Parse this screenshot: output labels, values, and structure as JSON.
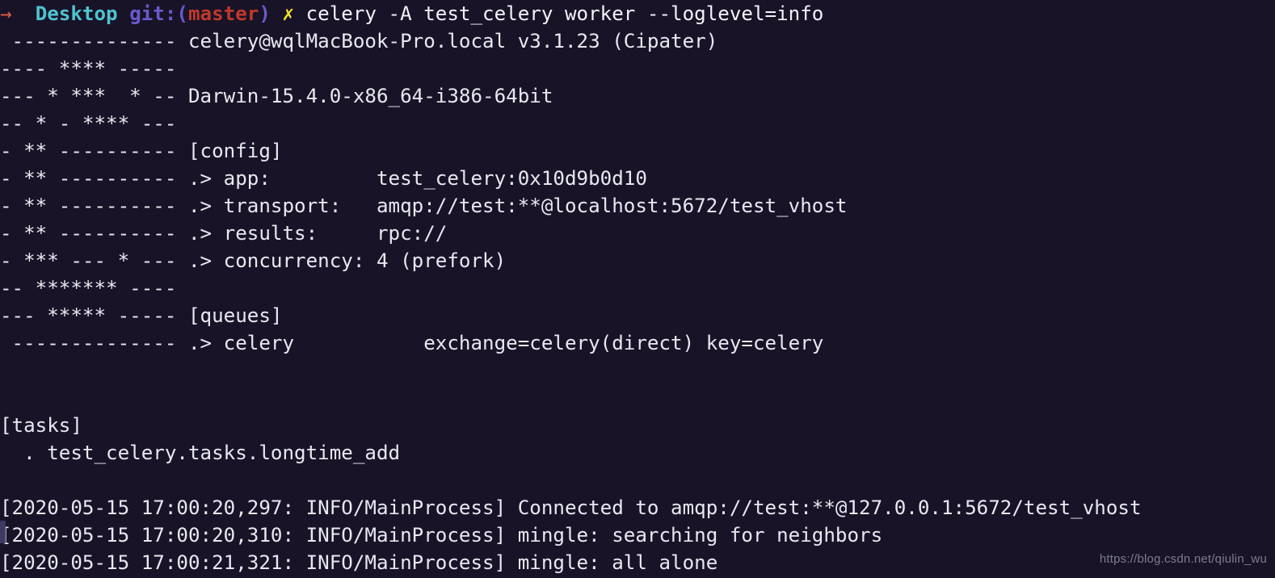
{
  "terminal": {
    "background_color": "#191328",
    "foreground_color": "#e8e8ee",
    "prompt": {
      "arrow": "→",
      "arrow_color": "#e05c4a",
      "directory": "Desktop",
      "directory_color": "#4fc4cf",
      "git_prefix": "git:(",
      "git_color": "#6a5acd",
      "branch": "master",
      "branch_color": "#c0392b",
      "git_suffix": ")",
      "status_mark": "✗",
      "status_mark_color": "#f2e42b",
      "command": "celery -A test_celery worker --loglevel=info"
    },
    "banner": {
      "art_lines": [
        " --------------",
        "---- **** -----",
        "--- * ***  * --",
        "-- * - **** ---",
        "- ** ----------",
        "- ** ----------",
        "- ** ----------",
        "- ** ----------",
        "- *** --- * ---",
        "-- ******* ----",
        "--- ***** -----",
        " --------------"
      ],
      "right_lines": [
        "celery@wqlMacBook-Pro.local v3.1.23 (Cipater)",
        "",
        "Darwin-15.4.0-x86_64-i386-64bit",
        "",
        "[config]",
        ".> app:         test_celery:0x10d9b0d10",
        ".> transport:   amqp://test:**@localhost:5672/test_vhost",
        ".> results:     rpc://",
        ".> concurrency: 4 (prefork)",
        "",
        "[queues]",
        ".> celery           exchange=celery(direct) key=celery"
      ]
    },
    "tasks": {
      "header": "[tasks]",
      "items": [
        "  . test_celery.tasks.longtime_add"
      ]
    },
    "logs": [
      "[2020-05-15 17:00:20,297: INFO/MainProcess] Connected to amqp://test:**@127.0.0.1:5672/test_vhost",
      "[2020-05-15 17:00:20,310: INFO/MainProcess] mingle: searching for neighbors",
      "[2020-05-15 17:00:21,321: INFO/MainProcess] mingle: all alone"
    ]
  },
  "watermark": {
    "text": "https://blog.csdn.net/qiulin_wu",
    "color": "#7c7c8c"
  }
}
